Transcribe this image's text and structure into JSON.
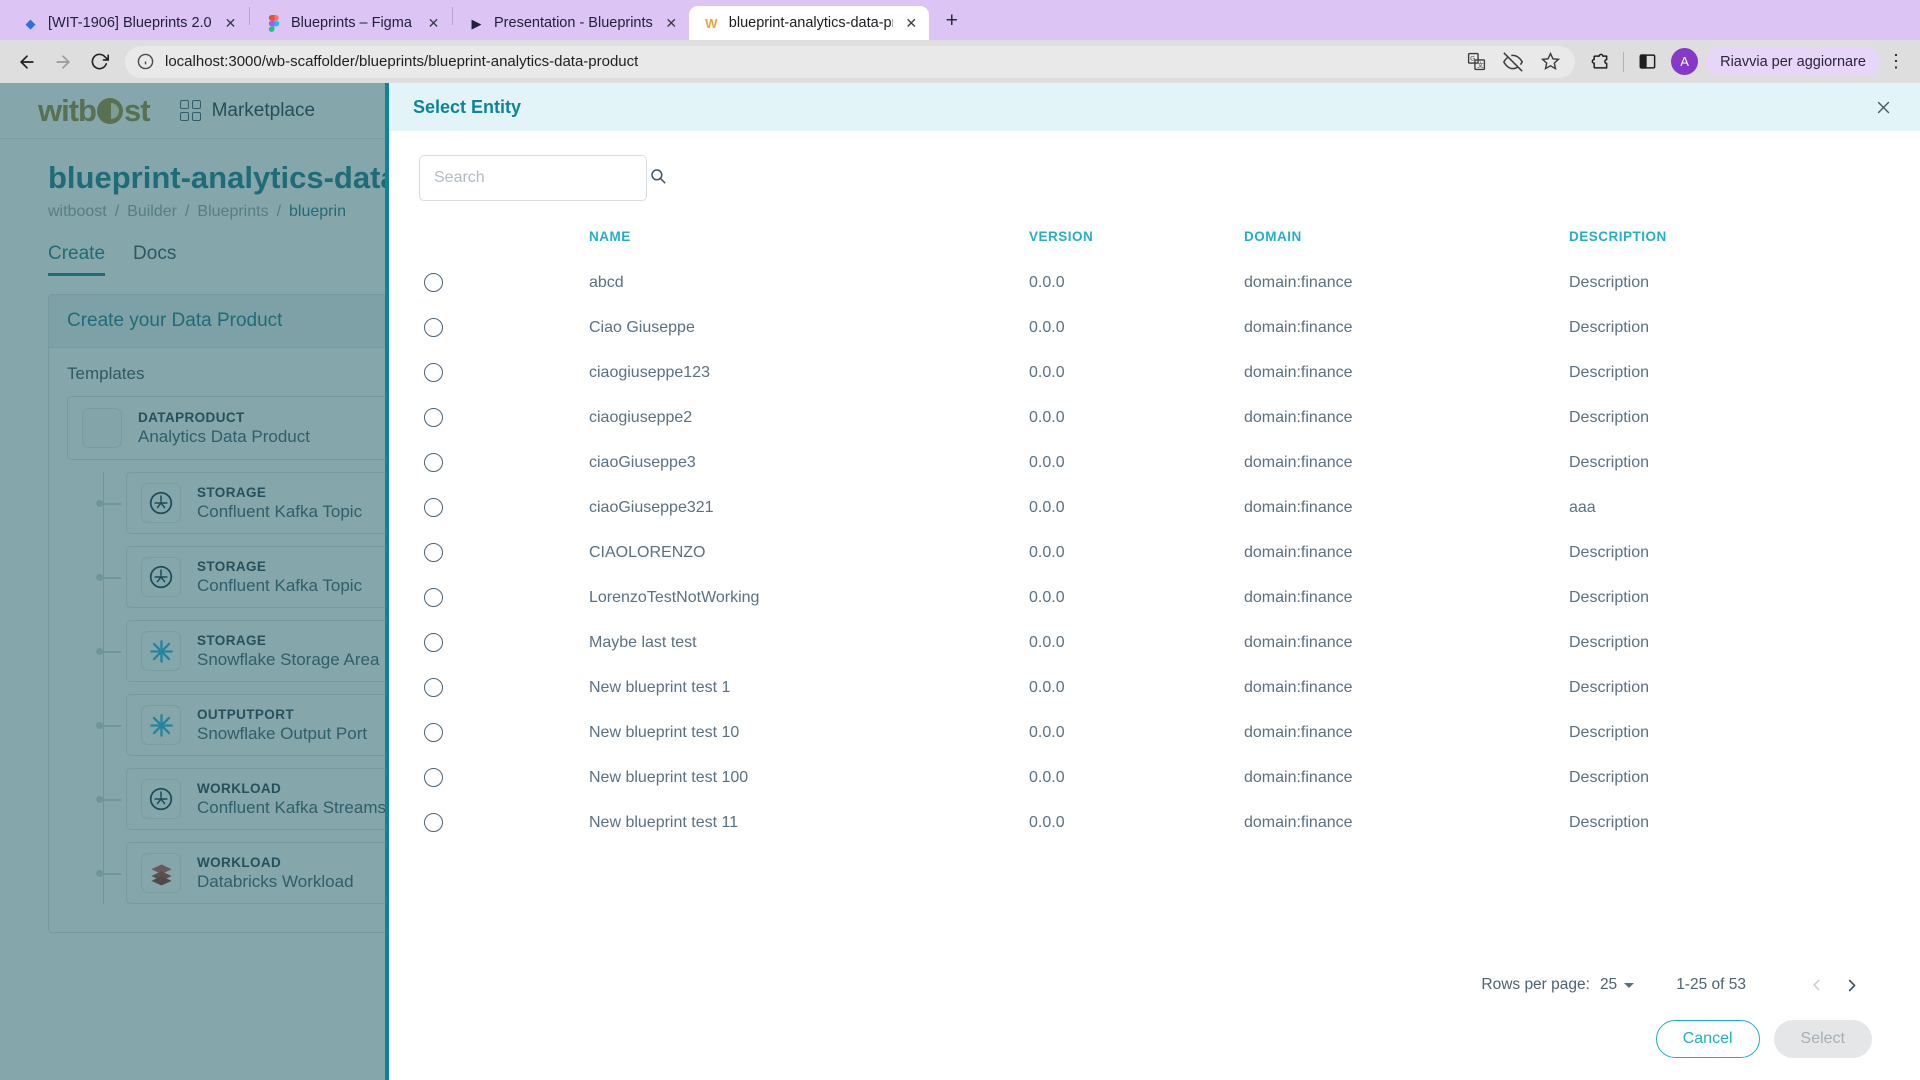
{
  "browser": {
    "tabs": [
      {
        "title": "[WIT-1906] Blueprints 2.0 -",
        "favicon": "◆",
        "favicon_color": "#2c6fe0",
        "active": false,
        "close_label": "✕"
      },
      {
        "title": "Blueprints – Figma",
        "favicon": "figma-icon",
        "favicon_color": "#f24e1e",
        "active": false,
        "close_label": "✕"
      },
      {
        "title": "Presentation - Blueprints",
        "favicon": "▶",
        "favicon_color": "#1a1a1a",
        "active": false,
        "close_label": "✕"
      },
      {
        "title": "blueprint-analytics-data-pro",
        "favicon": "W",
        "favicon_color": "#f2a03d",
        "active": true,
        "close_label": "✕"
      }
    ],
    "new_tab_label": "+",
    "url": "localhost:3000/wb-scaffolder/blueprints/blueprint-analytics-data-product",
    "nav": {
      "back": "back-icon",
      "forward": "forward-icon",
      "reload": "reload-icon",
      "site_info": "info-icon"
    },
    "toolbar_icons": [
      "translate-icon",
      "hidden-eye-icon",
      "bookmark-star-icon",
      "extensions-icon",
      "side-panel-icon"
    ],
    "avatar_initial": "A",
    "update_label": "Riavvia per aggiornare",
    "menu_label": "⋮"
  },
  "app": {
    "logo_text_left": "witb",
    "logo_text_right": "st",
    "marketplace_label": "Marketplace",
    "page_title": "blueprint-analytics-data-p",
    "breadcrumb": [
      "witboost",
      "Builder",
      "Blueprints",
      "blueprin"
    ],
    "tabs": [
      {
        "label": "Create",
        "selected": true
      },
      {
        "label": "Docs",
        "selected": false
      }
    ],
    "panel_title": "Create your Data Product",
    "panel_subtitle": "Templates",
    "templates": [
      {
        "kind": "DATAPRODUCT",
        "name": "Analytics Data Product",
        "icon": "empty-icon",
        "root": true
      },
      {
        "kind": "STORAGE",
        "name": "Confluent Kafka Topic",
        "icon": "confluent-icon",
        "root": false
      },
      {
        "kind": "STORAGE",
        "name": "Confluent Kafka Topic",
        "icon": "confluent-icon",
        "root": false
      },
      {
        "kind": "STORAGE",
        "name": "Snowflake Storage Area",
        "icon": "snowflake-icon",
        "root": false
      },
      {
        "kind": "OUTPUTPORT",
        "name": "Snowflake Output Port",
        "icon": "snowflake-icon",
        "root": false
      },
      {
        "kind": "WORKLOAD",
        "name": "Confluent Kafka Streams Workloa",
        "icon": "confluent-icon",
        "root": false
      },
      {
        "kind": "WORKLOAD",
        "name": "Databricks Workload",
        "icon": "databricks-icon",
        "root": false
      }
    ]
  },
  "modal": {
    "title": "Select Entity",
    "close_label": "✕",
    "search": {
      "value": "",
      "placeholder": "Search",
      "icon": "search-icon"
    },
    "columns": [
      "NAME",
      "VERSION",
      "DOMAIN",
      "DESCRIPTION"
    ],
    "rows": [
      {
        "name": "abcd",
        "version": "0.0.0",
        "domain": "domain:finance",
        "description": "Description"
      },
      {
        "name": "Ciao Giuseppe",
        "version": "0.0.0",
        "domain": "domain:finance",
        "description": "Description"
      },
      {
        "name": "ciaogiuseppe123",
        "version": "0.0.0",
        "domain": "domain:finance",
        "description": "Description"
      },
      {
        "name": "ciaogiuseppe2",
        "version": "0.0.0",
        "domain": "domain:finance",
        "description": "Description"
      },
      {
        "name": "ciaoGiuseppe3",
        "version": "0.0.0",
        "domain": "domain:finance",
        "description": "Description"
      },
      {
        "name": "ciaoGiuseppe321",
        "version": "0.0.0",
        "domain": "domain:finance",
        "description": "aaa"
      },
      {
        "name": "CIAOLORENZO",
        "version": "0.0.0",
        "domain": "domain:finance",
        "description": "Description"
      },
      {
        "name": "LorenzoTestNotWorking",
        "version": "0.0.0",
        "domain": "domain:finance",
        "description": "Description"
      },
      {
        "name": "Maybe last test",
        "version": "0.0.0",
        "domain": "domain:finance",
        "description": "Description"
      },
      {
        "name": "New blueprint test 1",
        "version": "0.0.0",
        "domain": "domain:finance",
        "description": "Description"
      },
      {
        "name": "New blueprint test 10",
        "version": "0.0.0",
        "domain": "domain:finance",
        "description": "Description"
      },
      {
        "name": "New blueprint test 100",
        "version": "0.0.0",
        "domain": "domain:finance",
        "description": "Description"
      },
      {
        "name": "New blueprint test 11",
        "version": "0.0.0",
        "domain": "domain:finance",
        "description": "Description"
      }
    ],
    "pagination": {
      "rows_per_page_label": "Rows per page:",
      "rows_per_page_value": "25",
      "range_label": "1-25 of 53",
      "prev_label": "‹",
      "next_label": "›"
    },
    "buttons": {
      "cancel": "Cancel",
      "select": "Select"
    }
  },
  "colors": {
    "accent_teal": "#0f8496",
    "header_bg": "#e2f4f7",
    "column_header": "#23b0c4",
    "tabstrip": "#dcc5f5",
    "backdrop": "rgba(33,92,100,0.55)"
  }
}
